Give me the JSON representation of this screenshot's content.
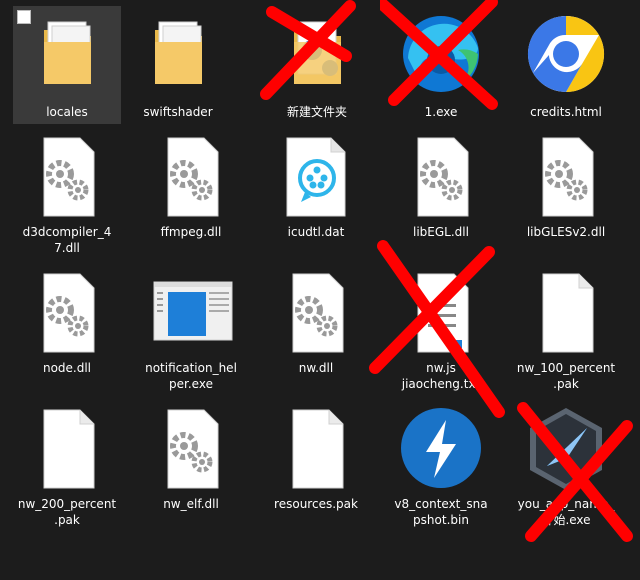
{
  "files": [
    {
      "name": "locales",
      "icon": "folder-icon",
      "selected": true
    },
    {
      "name": "swiftshader",
      "icon": "folder-icon"
    },
    {
      "name": "新建文件夹",
      "icon": "folder-icon",
      "crossed": true
    },
    {
      "name": "1.exe",
      "icon": "edge-browser-icon",
      "crossed": true
    },
    {
      "name": "credits.html",
      "icon": "chrome-browser-icon"
    },
    {
      "name": "d3dcompiler_4\n7.dll",
      "icon": "dll-gear-icon"
    },
    {
      "name": "ffmpeg.dll",
      "icon": "dll-gear-icon"
    },
    {
      "name": "icudtl.dat",
      "icon": "media-player-icon"
    },
    {
      "name": "libEGL.dll",
      "icon": "dll-gear-icon"
    },
    {
      "name": "libGLESv2.dll",
      "icon": "dll-gear-icon"
    },
    {
      "name": "node.dll",
      "icon": "dll-gear-icon"
    },
    {
      "name": "notification_hel\nper.exe",
      "icon": "app-window-icon"
    },
    {
      "name": "nw.dll",
      "icon": "dll-gear-icon"
    },
    {
      "name": "nw.js\njiaocheng.txt",
      "icon": "text-file-icon",
      "crossed": true
    },
    {
      "name": "nw_100_percent\n.pak",
      "icon": "blank-file-icon"
    },
    {
      "name": "nw_200_percent\n.pak",
      "icon": "blank-file-icon"
    },
    {
      "name": "nw_elf.dll",
      "icon": "dll-gear-icon"
    },
    {
      "name": "resources.pak",
      "icon": "blank-file-icon"
    },
    {
      "name": "v8_context_sna\npshot.bin",
      "icon": "lightning-icon"
    },
    {
      "name": "you_app_name_\n开始.exe",
      "icon": "compass-app-icon",
      "crossed": true
    }
  ],
  "colors": {
    "background": "#1c1c1c",
    "selection": "#3a3a3a",
    "cross": "#ff0000",
    "folder": "#f5c968"
  }
}
